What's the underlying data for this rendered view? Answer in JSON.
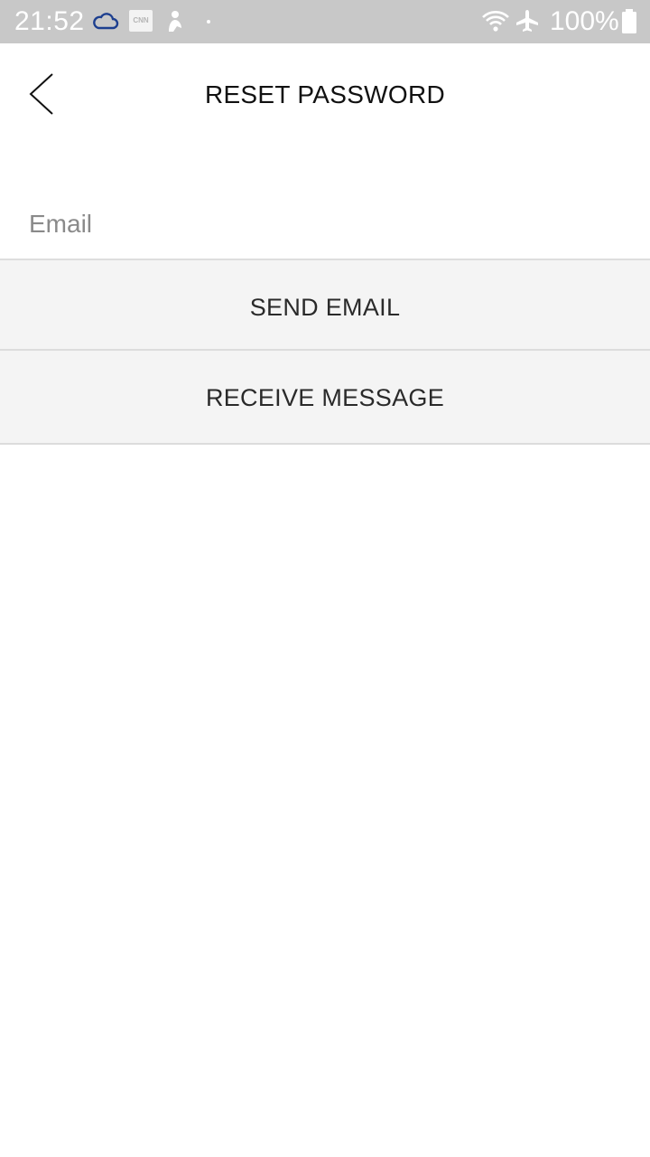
{
  "status_bar": {
    "time": "21:52",
    "battery": "100%",
    "icons": [
      "cloud-icon",
      "cnn-icon",
      "person-icon",
      "dot-icon",
      "wifi-icon",
      "airplane-icon",
      "battery-icon"
    ],
    "cnn_label": "CNN"
  },
  "header": {
    "title": "RESET PASSWORD",
    "back_icon": "chevron-left-icon"
  },
  "form": {
    "email_placeholder": "Email",
    "email_value": ""
  },
  "actions": {
    "send_email_label": "SEND EMAIL",
    "receive_message_label": "RECEIVE MESSAGE"
  },
  "colors": {
    "status_bar_bg": "#c8c8c8",
    "button_bg": "#f4f4f4",
    "divider": "#dcdcdc",
    "cloud_accent": "#1d3f8f"
  }
}
